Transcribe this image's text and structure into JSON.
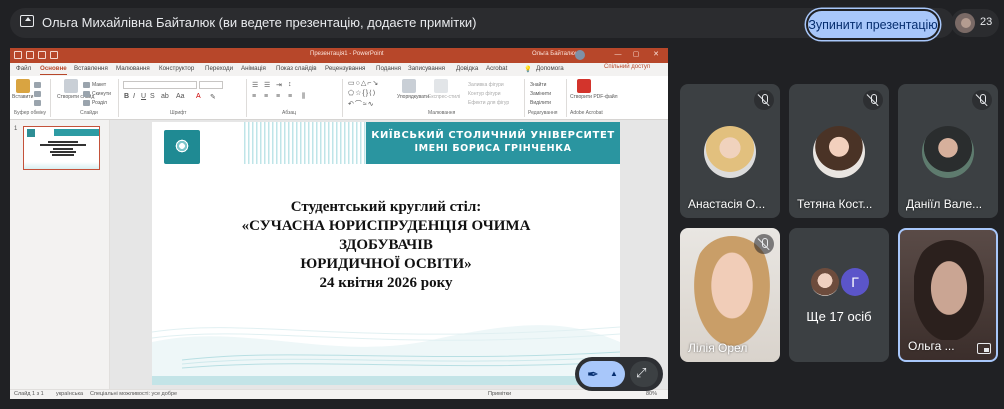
{
  "presentation_banner": {
    "text": "Ольга Михайлівна Байталюк (ви ведете презентацію, додаєте примітки)",
    "stop_button": "Зупинити презентацію",
    "participant_count": "23"
  },
  "powerpoint": {
    "window_title": "Презентація1 - PowerPoint",
    "user_name": "Ольга Байталюк",
    "user_initials": "ОБ",
    "tabs": [
      "Файл",
      "Основне",
      "Вставлення",
      "Малювання",
      "Конструктор",
      "Переходи",
      "Анімація",
      "Показ слайдів",
      "Рецензування",
      "Подання",
      "Записування",
      "Довідка",
      "Acrobat"
    ],
    "active_tab": "Основне",
    "search_label": "Допомога",
    "share_label": "Спільний доступ",
    "ribbon": {
      "paste": "Вставити",
      "clipboard_group": "Буфер обміну",
      "new_slide": "Створити слайд",
      "layout": "Макет",
      "reset": "Скинути",
      "section": "Розділ",
      "slides_group": "Слайди",
      "font_group": "Шрифт",
      "paragraph_group": "Абзац",
      "arrange": "Упорядкувати",
      "quick_styles": "Експрес-стилі",
      "shape_fill": "Заливка фігури",
      "shape_outline": "Контур фігури",
      "shape_effects": "Ефекти для фігур",
      "drawing_group": "Малювання",
      "find": "Знайти",
      "replace": "Замінити",
      "select": "Виділити",
      "editing_group": "Редагування",
      "create_pdf": "Створити PDF-файл",
      "acrobat_group": "Adobe Acrobat"
    },
    "slide_number": "1",
    "slide": {
      "university_line1": "КИЇВСЬКИЙ СТОЛИЧНИЙ УНІВЕРСИТЕТ",
      "university_line2": "ІМЕНІ БОРИСА ГРІНЧЕНКА",
      "title_lines": [
        "Студентський круглий стіл:",
        "«СУЧАСНА ЮРИСПРУДЕНЦІЯ ОЧИМА",
        "ЗДОБУВАЧІВ",
        "ЮРИДИЧНОЇ ОСВІТИ»",
        "24 квітня 2026 року"
      ]
    },
    "status_bar": {
      "slide_of": "Слайд 1 з 1",
      "language": "українська",
      "accessibility": "Спеціальні можливості: усе добре",
      "notes": "Примітки",
      "zoom": "80%"
    }
  },
  "participants": [
    {
      "name": "Анастасія О...",
      "muted": true
    },
    {
      "name": "Тетяна Кост...",
      "muted": true
    },
    {
      "name": "Даніїл Вале...",
      "muted": true
    },
    {
      "name": "Лілія Орел",
      "muted": true
    },
    {
      "name": "Ще 17 осіб",
      "avatar_letter": "Г"
    },
    {
      "name": "Ольга ..."
    }
  ],
  "colors": {
    "accent_button": "#a8c7fa",
    "powerpoint_red": "#b7472a",
    "slide_teal": "#2a95a0",
    "background": "#202124"
  }
}
